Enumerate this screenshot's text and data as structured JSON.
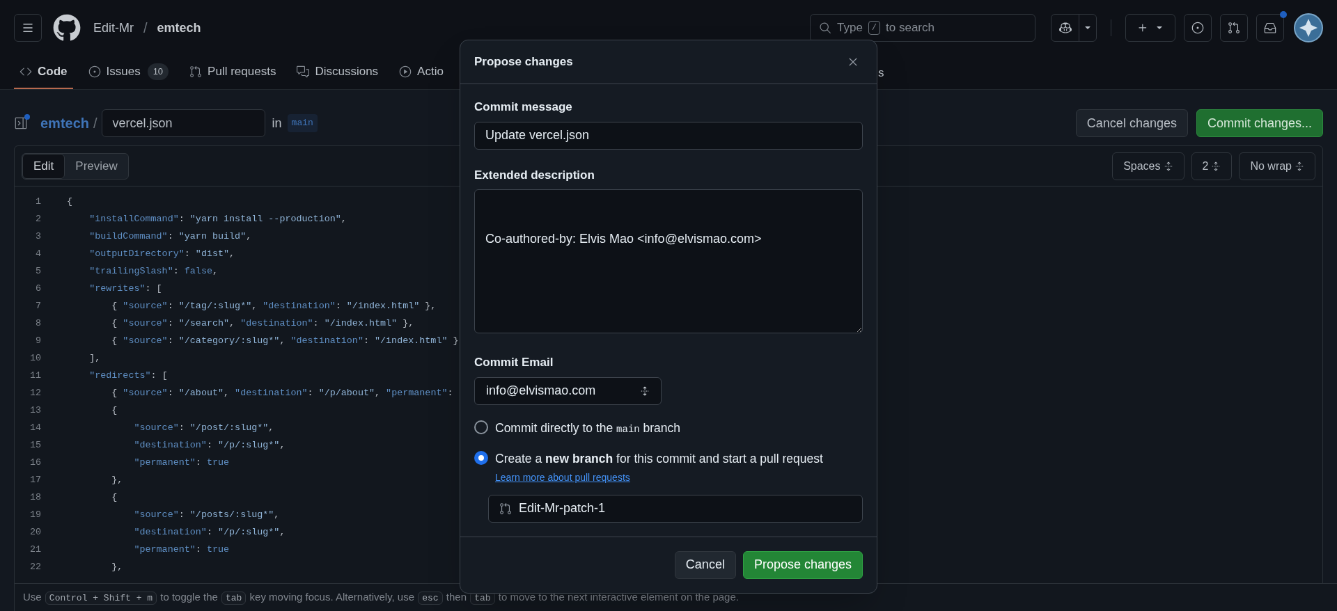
{
  "header": {
    "owner": "Edit-Mr",
    "separator": "/",
    "repo": "emtech",
    "search": {
      "before": "Type",
      "key": "/",
      "after": "to search"
    },
    "inbox_unread": true
  },
  "tabs": [
    {
      "label": "Code",
      "selected": true
    },
    {
      "label": "Issues",
      "count": "10",
      "selected": false
    },
    {
      "label": "Pull requests",
      "selected": false
    },
    {
      "label": "Discussions",
      "selected": false
    },
    {
      "label": "Actio",
      "selected": false
    }
  ],
  "tab_fragment": "s",
  "file": {
    "repo": "emtech",
    "separator": "/",
    "filename": "vercel.json",
    "in": "in",
    "branch": "main",
    "sidebar_unread": true
  },
  "actions": [
    {
      "label": "Cancel changes",
      "kind": "secondary"
    },
    {
      "label": "Commit changes...",
      "kind": "primary"
    }
  ],
  "editor": {
    "modes": [
      {
        "label": "Edit",
        "selected": true
      },
      {
        "label": "Preview",
        "selected": false
      }
    ],
    "options": [
      "Spaces",
      "2",
      "No wrap"
    ],
    "lines": [
      {
        "number": "1",
        "text": "{"
      },
      {
        "number": "2",
        "text": "    \"installCommand\": \"yarn install --production\","
      },
      {
        "number": "3",
        "text": "    \"buildCommand\": \"yarn build\","
      },
      {
        "number": "4",
        "text": "    \"outputDirectory\": \"dist\","
      },
      {
        "number": "5",
        "text": "    \"trailingSlash\": false,"
      },
      {
        "number": "6",
        "text": "    \"rewrites\": ["
      },
      {
        "number": "7",
        "text": "        { \"source\": \"/tag/:slug*\", \"destination\": \"/index.html\" },"
      },
      {
        "number": "8",
        "text": "        { \"source\": \"/search\", \"destination\": \"/index.html\" },"
      },
      {
        "number": "9",
        "text": "        { \"source\": \"/category/:slug*\", \"destination\": \"/index.html\" }"
      },
      {
        "number": "10",
        "text": "    ],"
      },
      {
        "number": "11",
        "text": "    \"redirects\": ["
      },
      {
        "number": "12",
        "text": "        { \"source\": \"/about\", \"destination\": \"/p/about\", \"permanent\":"
      },
      {
        "number": "13",
        "text": "        {"
      },
      {
        "number": "14",
        "text": "            \"source\": \"/post/:slug*\","
      },
      {
        "number": "15",
        "text": "            \"destination\": \"/p/:slug*\","
      },
      {
        "number": "16",
        "text": "            \"permanent\": true"
      },
      {
        "number": "17",
        "text": "        },"
      },
      {
        "number": "18",
        "text": "        {"
      },
      {
        "number": "19",
        "text": "            \"source\": \"/posts/:slug*\","
      },
      {
        "number": "20",
        "text": "            \"destination\": \"/p/:slug*\","
      },
      {
        "number": "21",
        "text": "            \"permanent\": true"
      },
      {
        "number": "22",
        "text": "        },"
      }
    ]
  },
  "help": [
    {
      "kind": "text",
      "text": "Use "
    },
    {
      "kind": "kbd",
      "text": "Control + Shift + m"
    },
    {
      "kind": "text",
      "text": " to toggle the "
    },
    {
      "kind": "kbd",
      "text": "tab"
    },
    {
      "kind": "text",
      "text": " key moving focus. Alternatively, use "
    },
    {
      "kind": "kbd",
      "text": "esc"
    },
    {
      "kind": "text",
      "text": " then "
    },
    {
      "kind": "kbd",
      "text": "tab"
    },
    {
      "kind": "text",
      "text": " to move to the next interactive element on the page."
    }
  ],
  "dialog": {
    "title": "Propose changes",
    "message_label": "Commit message",
    "message": "Update vercel.json",
    "description_label": "Extended description",
    "description": "\n\nCo-authored-by: Elvis Mao <info@elvismao.com>",
    "email_label": "Commit Email",
    "email": "info@elvismao.com",
    "options": [
      {
        "selected": false,
        "parts": [
          {
            "kind": "text",
            "text": "Commit directly to the "
          },
          {
            "kind": "code",
            "text": "main"
          },
          {
            "kind": "text",
            "text": " branch"
          }
        ]
      },
      {
        "selected": true,
        "parts": [
          {
            "kind": "text",
            "text": "Create a **new branch** for this commit and start a pull request "
          },
          {
            "kind": "link",
            "text": "Learn more about pull requests"
          }
        ]
      }
    ],
    "branch": "Edit-Mr-patch-1",
    "buttons": [
      {
        "label": "Cancel",
        "kind": "secondary"
      },
      {
        "label": "Propose changes",
        "kind": "primary"
      }
    ]
  }
}
